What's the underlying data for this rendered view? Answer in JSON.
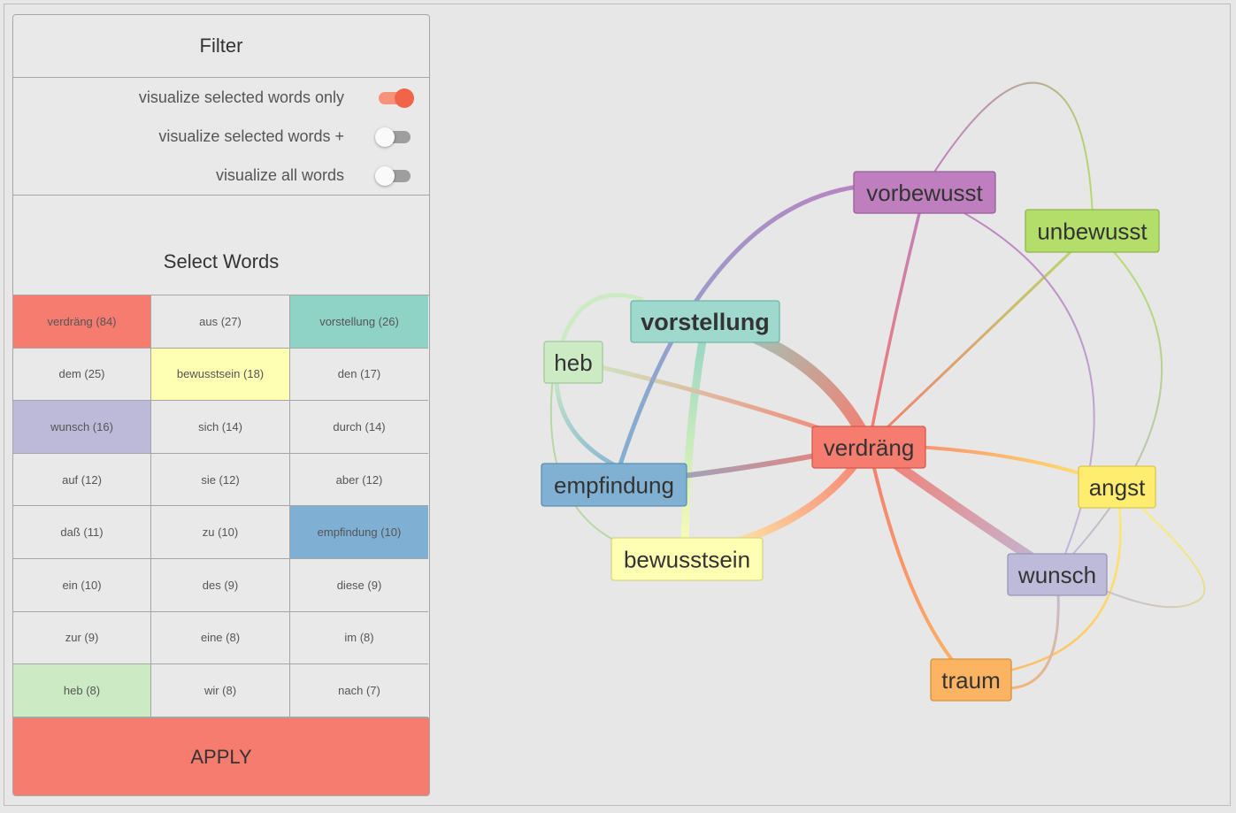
{
  "filter": {
    "title": "Filter",
    "toggles": [
      {
        "label": "visualize selected words only",
        "on": true
      },
      {
        "label": "visualize selected words +",
        "on": false
      },
      {
        "label": "visualize all words",
        "on": false
      }
    ]
  },
  "select_words": {
    "title": "Select Words",
    "cells": [
      {
        "label": "verdräng (84)",
        "color": "#f67c6f"
      },
      {
        "label": "aus (27)",
        "color": ""
      },
      {
        "label": "vorstellung (26)",
        "color": "#8fd3c6"
      },
      {
        "label": "dem (25)",
        "color": ""
      },
      {
        "label": "bewusstsein (18)",
        "color": "#ffffb3"
      },
      {
        "label": "den (17)",
        "color": ""
      },
      {
        "label": "wunsch (16)",
        "color": "#bdbad9"
      },
      {
        "label": "sich (14)",
        "color": ""
      },
      {
        "label": "durch (14)",
        "color": ""
      },
      {
        "label": "auf (12)",
        "color": ""
      },
      {
        "label": "sie (12)",
        "color": ""
      },
      {
        "label": "aber (12)",
        "color": ""
      },
      {
        "label": "daß (11)",
        "color": ""
      },
      {
        "label": "zu (10)",
        "color": ""
      },
      {
        "label": "empfindung (10)",
        "color": "#7fb0d3"
      },
      {
        "label": "ein (10)",
        "color": ""
      },
      {
        "label": "des (9)",
        "color": ""
      },
      {
        "label": "diese (9)",
        "color": ""
      },
      {
        "label": "zur (9)",
        "color": ""
      },
      {
        "label": "eine (8)",
        "color": ""
      },
      {
        "label": "im (8)",
        "color": ""
      },
      {
        "label": "heb (8)",
        "color": "#ccebc5"
      },
      {
        "label": "wir (8)",
        "color": ""
      },
      {
        "label": "nach (7)",
        "color": ""
      }
    ]
  },
  "apply_label": "APPLY",
  "graph": {
    "nodes": [
      {
        "id": "vorbewusst",
        "label": "vorbewusst",
        "color": "#bf7fbf",
        "border": "#9a5f9a",
        "bold": false
      },
      {
        "id": "unbewusst",
        "label": "unbewusst",
        "color": "#b3de69",
        "border": "#8fb54f",
        "bold": false
      },
      {
        "id": "vorstellung",
        "label": "vorstellung",
        "color": "#9fd8cc",
        "border": "#70b5a8",
        "bold": true
      },
      {
        "id": "heb",
        "label": "heb",
        "color": "#ccebc5",
        "border": "#a3c79b",
        "bold": false
      },
      {
        "id": "verdraeng",
        "label": "verdräng",
        "color": "#f67c6f",
        "border": "#d45a4d",
        "bold": false
      },
      {
        "id": "empfindung",
        "label": "empfindung",
        "color": "#80b1d3",
        "border": "#5c8fb3",
        "bold": false
      },
      {
        "id": "angst",
        "label": "angst",
        "color": "#ffed6f",
        "border": "#d9c550",
        "bold": false
      },
      {
        "id": "bewusstsein",
        "label": "bewusstsein",
        "color": "#ffffb3",
        "border": "#d6d68a",
        "bold": false
      },
      {
        "id": "wunsch",
        "label": "wunsch",
        "color": "#bebada",
        "border": "#9a96b8",
        "bold": false
      },
      {
        "id": "traum",
        "label": "traum",
        "color": "#fdb462",
        "border": "#d6913f",
        "bold": false
      }
    ]
  }
}
